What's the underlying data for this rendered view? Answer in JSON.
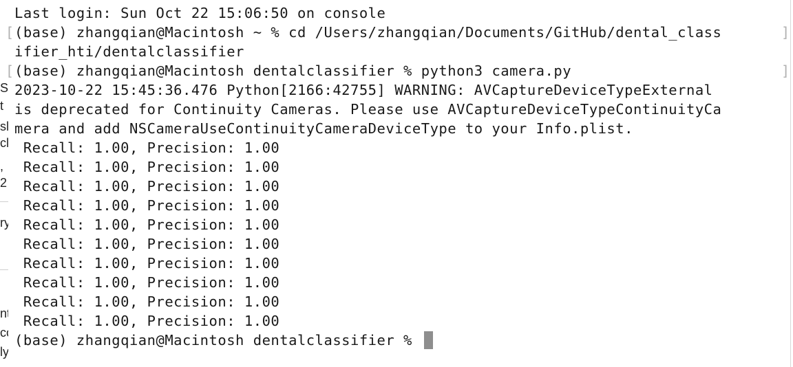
{
  "background_app": {
    "fragments": [
      "Sc",
      "t",
      "sl",
      "cla",
      ",",
      "2",
      "ry",
      "nt",
      "co",
      "ly"
    ]
  },
  "terminal": {
    "lines": [
      "Last login: Sun Oct 22 15:06:50 on console",
      "(base) zhangqian@Macintosh ~ % cd /Users/zhangqian/Documents/GitHub/dental_class",
      "ifier_hti/dentalclassifier",
      "(base) zhangqian@Macintosh dentalclassifier % python3 camera.py",
      "2023-10-22 15:45:36.476 Python[2166:42755] WARNING: AVCaptureDeviceTypeExternal",
      "is deprecated for Continuity Cameras. Please use AVCaptureDeviceTypeContinuityCa",
      "mera and add NSCameraUseContinuityCameraDeviceType to your Info.plist.",
      " Recall: 1.00, Precision: 1.00",
      " Recall: 1.00, Precision: 1.00",
      " Recall: 1.00, Precision: 1.00",
      " Recall: 1.00, Precision: 1.00",
      " Recall: 1.00, Precision: 1.00",
      " Recall: 1.00, Precision: 1.00",
      " Recall: 1.00, Precision: 1.00",
      " Recall: 1.00, Precision: 1.00",
      " Recall: 1.00, Precision: 1.00",
      " Recall: 1.00, Precision: 1.00"
    ],
    "prompt": "(base) zhangqian@Macintosh dentalclassifier % ",
    "command_marks": {
      "open": "[",
      "close": "]"
    }
  }
}
